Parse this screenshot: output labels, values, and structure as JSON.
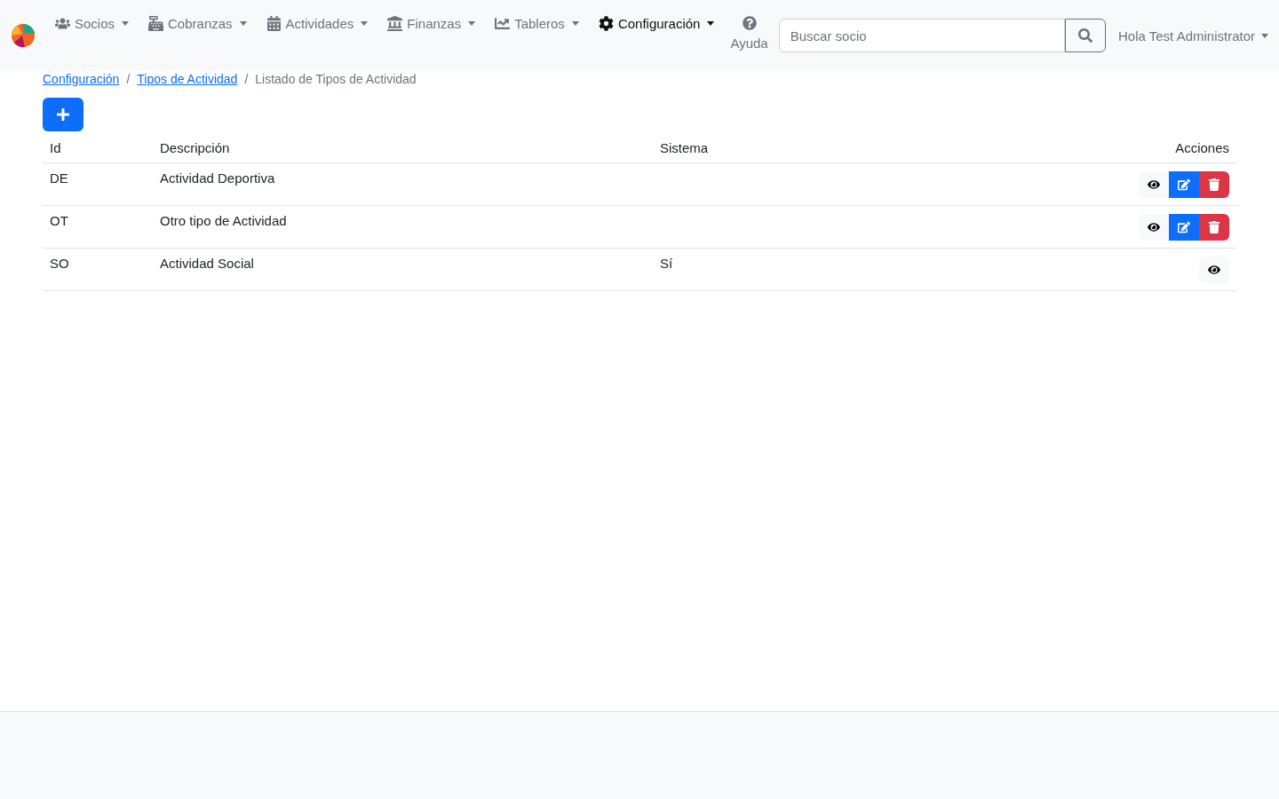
{
  "navbar": {
    "menus": [
      {
        "label": "Socios",
        "selected": false
      },
      {
        "label": "Cobranzas",
        "selected": false
      },
      {
        "label": "Actividades",
        "selected": false
      },
      {
        "label": "Finanzas",
        "selected": false
      },
      {
        "label": "Tableros",
        "selected": false
      },
      {
        "label": "Configuración",
        "selected": true
      }
    ],
    "help": "Ayuda",
    "search": {
      "placeholder": "Buscar socio"
    },
    "user": "Hola Test Administrator"
  },
  "breadcrumb": [
    {
      "label": "Configuración",
      "link": true
    },
    {
      "separator": "/",
      "label": "Tipos de Actividad",
      "link": true
    },
    {
      "separator": "/",
      "label": "Listado de Tipos de Actividad",
      "link": false
    }
  ],
  "table": {
    "columns": [
      "Id",
      "Descripción",
      "Sistema",
      "Acciones"
    ],
    "rows": [
      {
        "id": "DE",
        "description": "Actividad Deportiva",
        "system": "",
        "actions": [
          {
            "kind": "view"
          },
          {
            "kind": "edit"
          },
          {
            "kind": "delete"
          }
        ]
      },
      {
        "id": "OT",
        "description": "Otro tipo de Actividad",
        "system": "",
        "actions": [
          {
            "kind": "view"
          },
          {
            "kind": "edit"
          },
          {
            "kind": "delete"
          }
        ]
      },
      {
        "id": "SO",
        "description": "Actividad Social",
        "system": "Sí",
        "actions": [
          {
            "kind": "view"
          }
        ]
      }
    ]
  }
}
